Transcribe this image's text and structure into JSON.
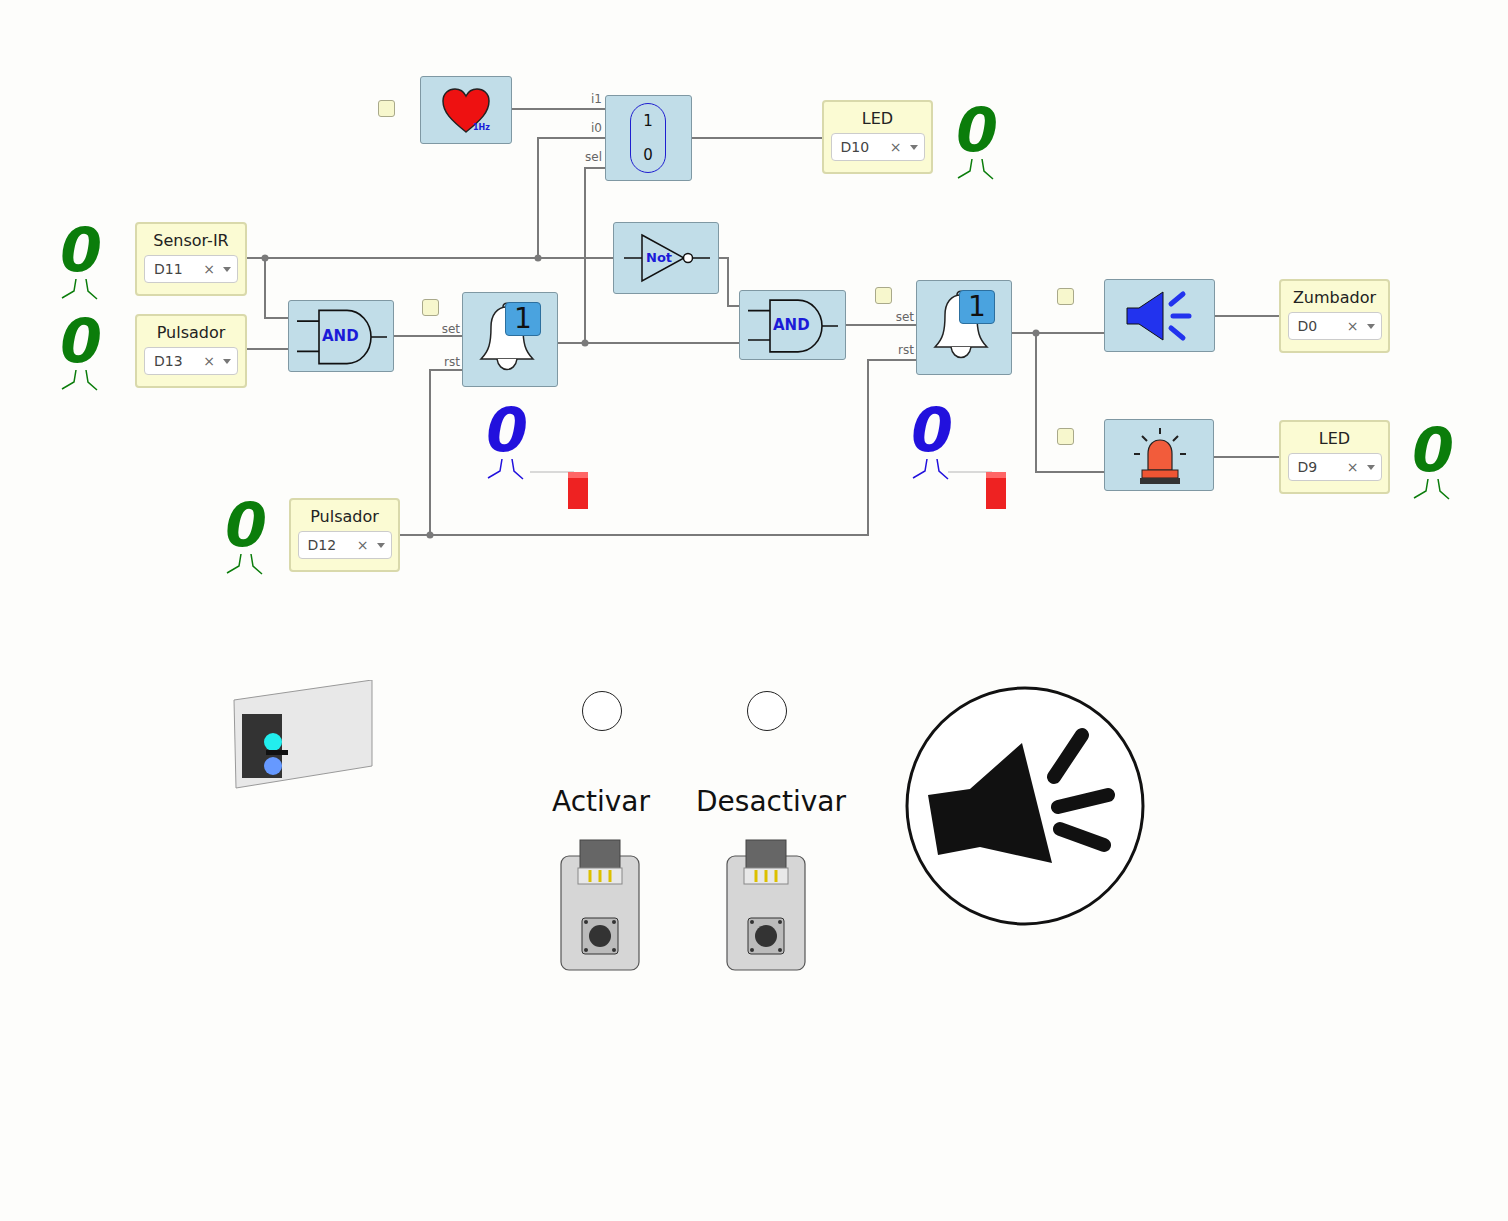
{
  "inputs": [
    {
      "label": "Sensor-IR",
      "pin": "D11",
      "clear": "×",
      "value": "0"
    },
    {
      "label": "Pulsador",
      "pin": "D13",
      "clear": "×",
      "value": "0"
    },
    {
      "label": "Pulsador",
      "pin": "D12",
      "clear": "×",
      "value": "0"
    }
  ],
  "outputs": [
    {
      "label": "LED",
      "pin": "D10",
      "clear": "×",
      "value": "0"
    },
    {
      "label": "Zumbador",
      "pin": "D0",
      "clear": "×"
    },
    {
      "label": "LED",
      "pin": "D9",
      "clear": "×",
      "value": "0"
    }
  ],
  "clock": {
    "label": "1Hz"
  },
  "mux": {
    "ports": [
      "i1",
      "i0",
      "sel"
    ],
    "options": [
      "1",
      "0"
    ]
  },
  "not_gate": {
    "label": "Not"
  },
  "and_gates": [
    {
      "label": "AND"
    },
    {
      "label": "AND"
    }
  ],
  "alarms": [
    {
      "badge": "1",
      "ports": [
        "set",
        "rst"
      ],
      "value": "0"
    },
    {
      "badge": "1",
      "ports": [
        "set",
        "rst"
      ],
      "value": "0"
    }
  ],
  "panel": {
    "leds": [
      {
        "label": "Activar",
        "on": false
      },
      {
        "label": "Desactivar",
        "on": false
      }
    ]
  }
}
